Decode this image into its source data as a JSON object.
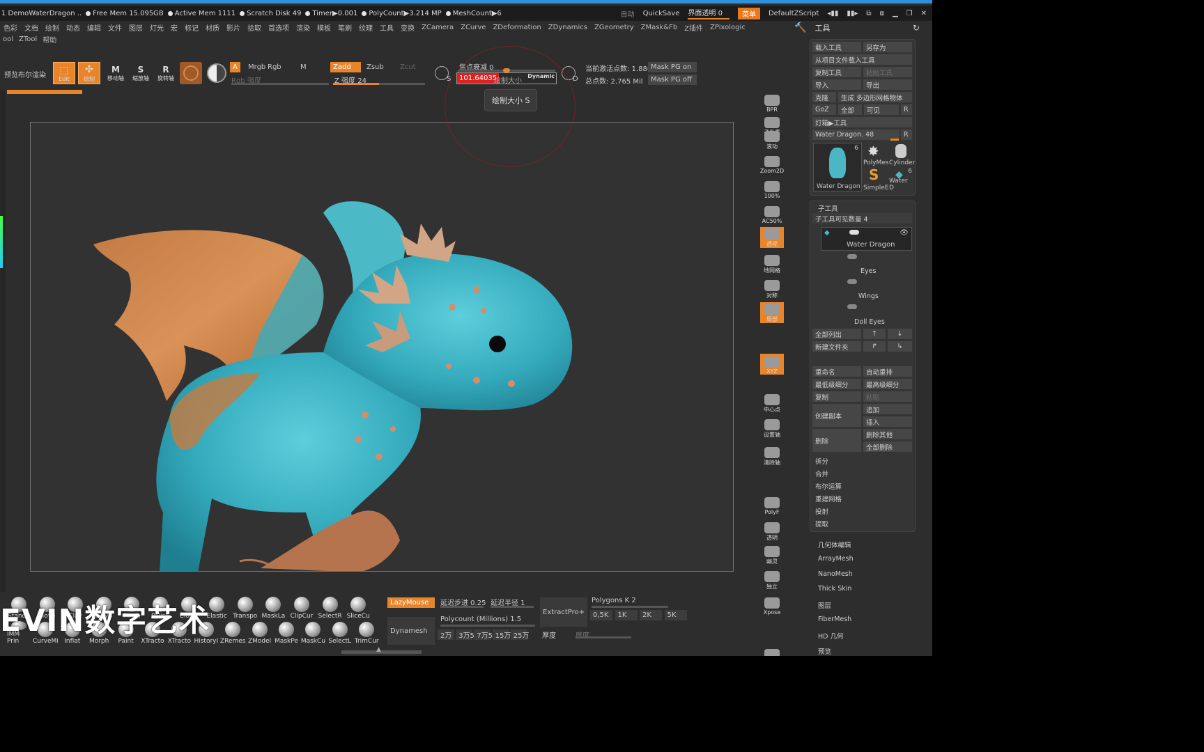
{
  "title_bar": {
    "doc_title": "1  DemoWaterDragon  ..",
    "stats": [
      "Free Mem 15.095GB",
      "Active Mem 1111",
      "Scratch Disk 49",
      "Timer▶0.001",
      "PolyCount▶3.214 MP",
      "MeshCount▶6"
    ],
    "auto_label": "自动",
    "quicksave": "QuickSave",
    "ui_transparency": "界面透明 0",
    "menu_btn": "菜单",
    "default_script": "DefaultZScript"
  },
  "menu": [
    "色彩",
    "文档",
    "绘制",
    "动态",
    "编辑",
    "文件",
    "图层",
    "灯光",
    "宏",
    "标记",
    "材质",
    "影片",
    "拾取",
    "首选项",
    "渲染",
    "模板",
    "笔刷",
    "纹理",
    "工具",
    "变换",
    "ZCamera",
    "ZCurve",
    "ZDeformation",
    "ZDynamics",
    "ZGeometry",
    "ZMask&Fb",
    "Z插件",
    "ZPixologic"
  ],
  "menu2": [
    "ool",
    "ZTool",
    "帮助"
  ],
  "toolbar": {
    "preview_render": "预览布尔渲染",
    "edit": "Edit",
    "draw": "绘制",
    "move": "移动轴",
    "scale": "缩放轴",
    "rotate": "旋转轴",
    "a": "A",
    "mrgb": "Mrgb",
    "rgb": "Rgb",
    "m": "M",
    "rgb_strength": "Rgb 强度",
    "zadd": "Zadd",
    "zsub": "Zsub",
    "zcut": "Zcut",
    "z_intensity": "Z 强度 24",
    "focal_shift": "焦点衰减 0",
    "draw_size_value": "101.64035",
    "draw_size_label": "绘制大小",
    "dynamic": "Dynamic",
    "active_points": "当前激活点数: 1.886 M",
    "total_points": "总点数: 2.765 Mil",
    "mask_pg_on": "Mask PG on",
    "mask_pg_off": "Mask PG off",
    "s_label": "S",
    "d_label": "D"
  },
  "tooltip": "绘制大小  S",
  "right_shelf": [
    "BPR",
    "子像素",
    "滚动",
    "Zoom2D",
    "100%",
    "AC50%",
    "透视",
    "地网格",
    "对称",
    "局部",
    "XYZ",
    "中心点",
    "设置轴",
    "清除轴",
    "PolyF",
    "透明",
    "幽灵",
    "独立",
    "Xpose",
    "On Off"
  ],
  "tool_panel": {
    "header": "工具",
    "load_tool": "载入工具",
    "save_as": "另存为",
    "load_from_project": "从项目文件载入工具",
    "copy_tool": "复制工具",
    "paste_tool": "粘贴工具",
    "import": "导入",
    "export": "导出",
    "clone": "克隆",
    "make_polymesh": "生成 多边形网格物体",
    "goz": "GoZ",
    "all": "全部",
    "visible": "可见",
    "r": "R",
    "lightbox_tools": "灯箱▶工具",
    "current_tool": "Water Dragon. 48",
    "thumbs": [
      {
        "label": "Water Dragon",
        "count": "6"
      },
      {
        "label": "PolyMes",
        "count": ""
      },
      {
        "label": "Cylinder",
        "count": ""
      },
      {
        "label": "SimpleE",
        "count": ""
      },
      {
        "label": "Water D",
        "count": "6"
      }
    ]
  },
  "subtool_panel": {
    "header": "子工具",
    "visible_count": "子工具可见数量 4",
    "items": [
      "Water Dragon",
      "Eyes",
      "Wings",
      "Doll Eyes"
    ],
    "list_all": "全部列出",
    "new_folder": "新建文件夹",
    "rename": "重命名",
    "auto_reorder": "自动重排",
    "lowest_subdiv": "最低级细分",
    "highest_subdiv": "最高级细分",
    "duplicate": "复制",
    "paste": "粘贴",
    "create_copy": "创建副本",
    "append": "追加",
    "insert": "插入",
    "delete": "删除",
    "delete_other": "删除其他",
    "delete_all": "全部删除",
    "split": "拆分",
    "merge": "合并",
    "boolean": "布尔运算",
    "remesh": "重建网格",
    "project": "投射",
    "extract": "提取"
  },
  "tool_subpalettes": [
    "几何体编辑",
    "ArrayMesh",
    "NanoMesh",
    "Thick Skin",
    "图层",
    "FiberMesh",
    "HD 几何",
    "预览"
  ],
  "bottom": {
    "brushes_row1": [
      "Standa",
      "Move",
      "Clay",
      "ClayB",
      "Pinch",
      "Polish",
      "Clothi",
      "Elastic",
      "Transpo",
      "MaskLa",
      "ClipCur",
      "SelectR",
      "SliceCu"
    ],
    "brushes_row2": [
      "IMM Prin",
      "CurveMi",
      "Inflat",
      "Morph",
      "Paint",
      "XTracto",
      "XTracto",
      "HistoryI",
      "ZRemes",
      "ZModel",
      "MaskPe",
      "MaskCu",
      "SelectL",
      "TrimCur"
    ],
    "lazymouse": "LazyMouse",
    "lazy_step": "延迟步进 0.25",
    "lazy_radius": "延迟半径 1",
    "dynamesh": "Dynamesh",
    "polycount": "Polycount (Millions) 1.5",
    "extractpro": "ExtractPro+",
    "polygons_k": "Polygons K 2",
    "k_options": [
      "0,5K",
      "1K",
      "2K",
      "5K"
    ],
    "counts": [
      "2万",
      "3万5",
      "7万5",
      "15万",
      "25万"
    ],
    "thickness": "厚度",
    "thickness2": "厚度"
  },
  "watermark": "EVIN数字艺术",
  "colors": {
    "accent": "#e8842a",
    "bg": "#2d2d2d",
    "panel": "#353535",
    "dragon": "#3fb3c2"
  }
}
